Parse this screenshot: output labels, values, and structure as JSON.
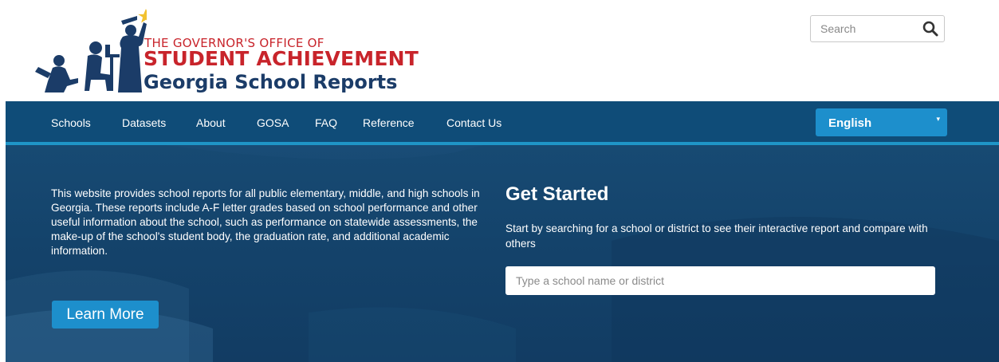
{
  "header": {
    "logo": {
      "line1": "THE GOVERNOR'S OFFICE OF",
      "line2": "STUDENT ACHIEVEMENT",
      "line3": "Georgia School Reports",
      "colors": {
        "red": "#c8242b",
        "navy": "#1b3c68",
        "star": "#f2c230"
      }
    },
    "search": {
      "placeholder": "Search",
      "icon": "magnifier-icon"
    }
  },
  "nav": {
    "items": [
      {
        "label": "Schools"
      },
      {
        "label": "Datasets"
      },
      {
        "label": "About"
      },
      {
        "label": "GOSA"
      },
      {
        "label": "FAQ"
      },
      {
        "label": "Reference"
      },
      {
        "label": "Contact Us"
      }
    ],
    "language": {
      "selected": "English",
      "icon": "caret-down-icon"
    },
    "colors": {
      "bar": "#0f4c78",
      "accent": "#1f95c7",
      "button": "#1d8fcc"
    }
  },
  "hero": {
    "intro": "This website provides school reports for all public elementary, middle, and high schools in Georgia. These reports include A-F letter grades based on school performance and other useful information about the school, such as performance on statewide assessments, the make-up of the school's student body, the graduation rate, and additional academic information.",
    "learn_more": "Learn More",
    "get_started": {
      "title": "Get Started",
      "description": "Start by searching for a school or district to see their interactive report and compare with others",
      "placeholder": "Type a school name or district"
    }
  }
}
